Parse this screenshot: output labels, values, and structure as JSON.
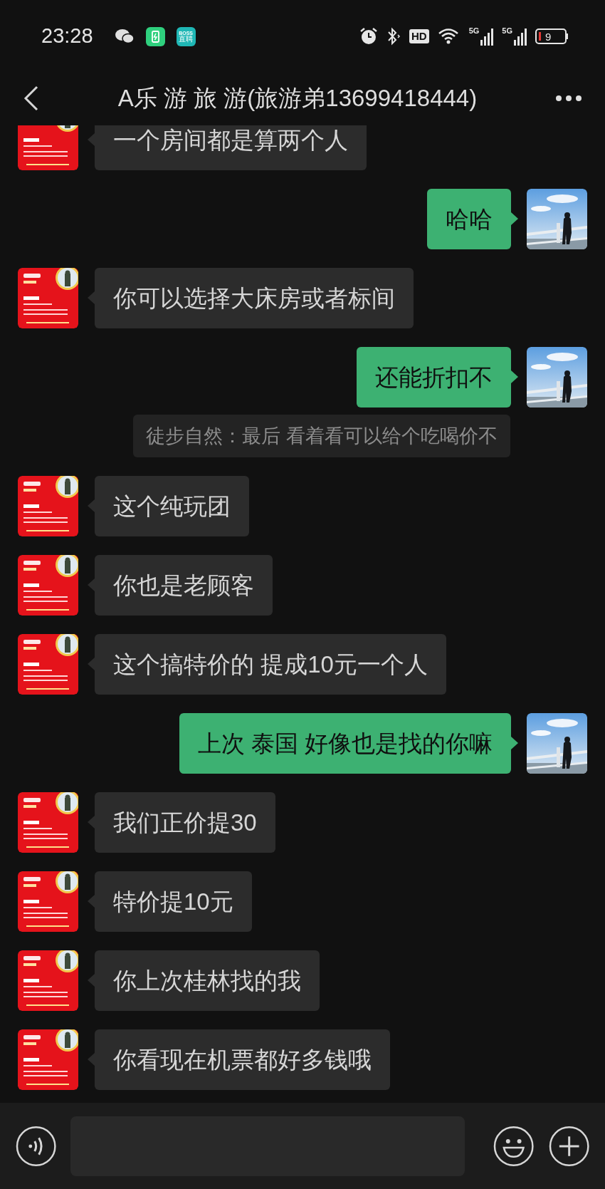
{
  "status_bar": {
    "time": "23:28",
    "app_icons": [
      {
        "kind": "chat"
      },
      {
        "kind": "battery"
      },
      {
        "kind": "boss",
        "label": "BOSS",
        "sublabel": "直聘"
      }
    ],
    "hd_label": "HD",
    "signals": [
      {
        "label": "5G"
      },
      {
        "label": "5G"
      }
    ],
    "battery": "9"
  },
  "header": {
    "title": "A乐 游 旅 游(旅游弟13699418444)"
  },
  "messages": [
    {
      "kind": "received",
      "text": "一个房间都是算两个人"
    },
    {
      "kind": "sent",
      "text": "哈哈"
    },
    {
      "kind": "received",
      "text": "你可以选择大床房或者标间"
    },
    {
      "kind": "sent",
      "text": "还能折扣不"
    },
    {
      "kind": "quote",
      "text": "徒步自然：最后 看着看可以给个吃喝价不"
    },
    {
      "kind": "received",
      "text": "这个纯玩团"
    },
    {
      "kind": "received",
      "text": "你也是老顾客"
    },
    {
      "kind": "received",
      "text": "这个搞特价的 提成10元一个人"
    },
    {
      "kind": "sent",
      "text": "上次 泰国 好像也是找的你嘛"
    },
    {
      "kind": "received",
      "text": "我们正价提30"
    },
    {
      "kind": "received",
      "text": "特价提10元"
    },
    {
      "kind": "received",
      "text": "你上次桂林找的我"
    },
    {
      "kind": "received",
      "text": "你看现在机票都好多钱哦"
    }
  ]
}
